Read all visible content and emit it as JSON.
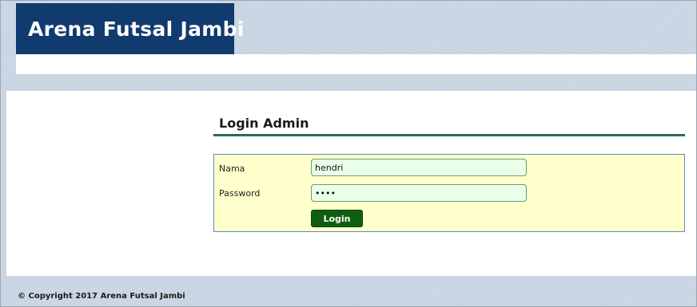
{
  "header": {
    "site_title": "Arena Futsal Jambi"
  },
  "main": {
    "section_title": "Login Admin",
    "form": {
      "nama_label": "Nama",
      "nama_value": "hendri",
      "password_label": "Password",
      "password_value": "pass",
      "login_button_label": "Login"
    }
  },
  "footer": {
    "copyright": "© Copyright 2017 Arena Futsal Jambi"
  },
  "colors": {
    "header_bg": "#113a6e",
    "page_bg": "#c9d5e3",
    "form_bg": "#ffffcc",
    "form_border": "#5e8fb5",
    "title_rule": "#2b6b5a",
    "input_bg": "#eaffea",
    "button_bg": "#0f5e0f"
  }
}
